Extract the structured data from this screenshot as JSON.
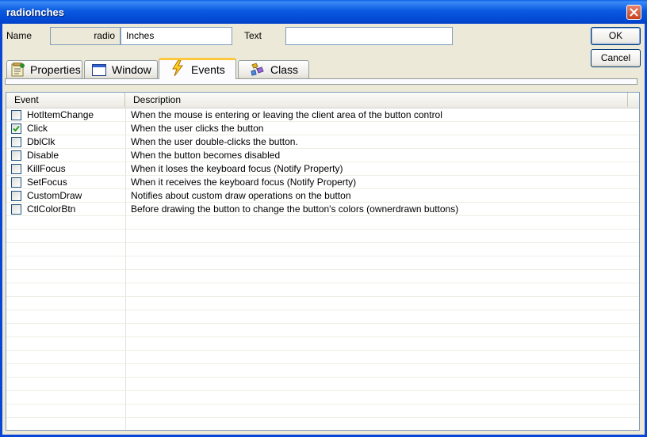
{
  "window": {
    "title": "radioInches"
  },
  "form": {
    "name_label": "Name",
    "name_prefix": "radio",
    "name_value": "Inches",
    "text_label": "Text",
    "text_value": ""
  },
  "buttons": {
    "ok_label": "OK",
    "cancel_label": "Cancel"
  },
  "tabs": [
    {
      "label": "Properties",
      "icon": "properties-icon",
      "active": false
    },
    {
      "label": "Window",
      "icon": "window-icon",
      "active": false
    },
    {
      "label": "Events",
      "icon": "lightning-icon",
      "active": true
    },
    {
      "label": "Class",
      "icon": "class-icon",
      "active": false
    }
  ],
  "table": {
    "columns": [
      "Event",
      "Description"
    ],
    "rows": [
      {
        "event": "HotItemChange",
        "description": "When the mouse is entering or leaving the client area of the button control",
        "checked": false
      },
      {
        "event": "Click",
        "description": "When the user clicks the button",
        "checked": true
      },
      {
        "event": "DblClk",
        "description": "When the user double-clicks the button.",
        "checked": false
      },
      {
        "event": "Disable",
        "description": "When the button becomes disabled",
        "checked": false
      },
      {
        "event": "KillFocus",
        "description": "When it loses the keyboard focus (Notify Property)",
        "checked": false
      },
      {
        "event": "SetFocus",
        "description": "When it receives the keyboard focus (Notify Property)",
        "checked": false
      },
      {
        "event": "CustomDraw",
        "description": "Notifies about custom draw operations on the button",
        "checked": false
      },
      {
        "event": "CtlColorBtn",
        "description": "Before drawing the button to change the button's colors (ownerdrawn buttons)",
        "checked": false
      }
    ]
  },
  "colors": {
    "titlebar": "#0a5ae0",
    "active_tab_accent": "#ffc83c",
    "dialog_bg": "#ece9d8",
    "check": "#21a121"
  }
}
